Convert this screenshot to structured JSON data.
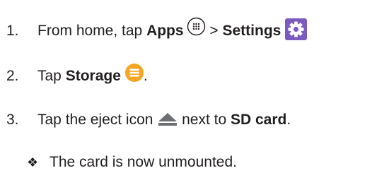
{
  "steps": [
    {
      "number": "1.",
      "parts": {
        "a": "From home, tap ",
        "b": "Apps",
        "c": " > ",
        "d": "Settings"
      },
      "icons": [
        "apps-icon",
        "settings-icon"
      ]
    },
    {
      "number": "2.",
      "parts": {
        "a": "Tap ",
        "b": "Storage",
        "c": "."
      },
      "icons": [
        "storage-icon"
      ]
    },
    {
      "number": "3.",
      "parts": {
        "a": "Tap the eject icon ",
        "b": " next to ",
        "c": "SD card",
        "d": "."
      },
      "icons": [
        "eject-icon"
      ]
    }
  ],
  "result": {
    "bullet": "❖",
    "text": "The card is now unmounted."
  },
  "colors": {
    "text": "#231f20",
    "settings_icon_bg": "#7b5bbf",
    "storage_icon_bg": "#f5a623",
    "eject_icon": "#6d6e71"
  }
}
